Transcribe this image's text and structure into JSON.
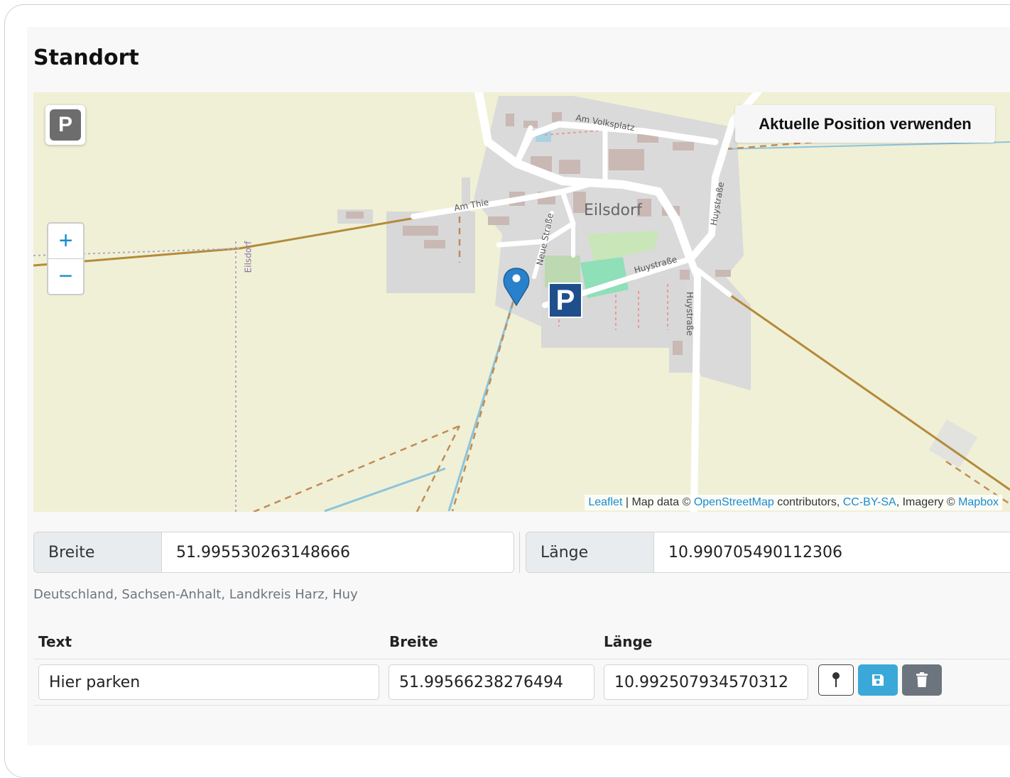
{
  "section_title": "Standort",
  "map": {
    "parking_toggle_label": "P",
    "zoom_in": "+",
    "zoom_out": "−",
    "current_position_button": "Aktuelle Position verwenden",
    "labels": {
      "village": "Eilsdorf",
      "am_volksplatz": "Am Volksplatz",
      "am_thie": "Am Thie",
      "neue_strasse": "Neue Straße",
      "huystrasse_1": "Huystraße",
      "huystrasse_2": "Huystraße",
      "huystrasse_3": "Huystraße",
      "eilsdorf_road": "Eilsdorf"
    },
    "parking_marker": "P",
    "attribution": {
      "leaflet": "Leaflet",
      "sep": " | Map data © ",
      "osm": "OpenStreetMap",
      "contrib": " contributors, ",
      "ccbysa": "CC-BY-SA",
      "imagery": ", Imagery © ",
      "mapbox": "Mapbox"
    }
  },
  "coords": {
    "lat_label": "Breite",
    "lat_value": "51.995530263148666",
    "lng_label": "Länge",
    "lng_value": "10.990705490112306"
  },
  "address": "Deutschland, Sachsen-Anhalt, Landkreis Harz, Huy",
  "table": {
    "headers": {
      "text": "Text",
      "lat": "Breite",
      "lng": "Länge"
    },
    "rows": [
      {
        "text": "Hier parken",
        "lat": "51.99566238276494",
        "lng": "10.992507934570312"
      }
    ]
  },
  "colors": {
    "accent": "#1a8ccf",
    "save_button": "#3aa8d8",
    "delete_button": "#6c757d",
    "marker_blue": "#2a81cb",
    "parking_blue": "#1f4e8c"
  },
  "icons": {
    "locate": "pin-icon",
    "save": "floppy-disk-icon",
    "delete": "trash-icon"
  }
}
